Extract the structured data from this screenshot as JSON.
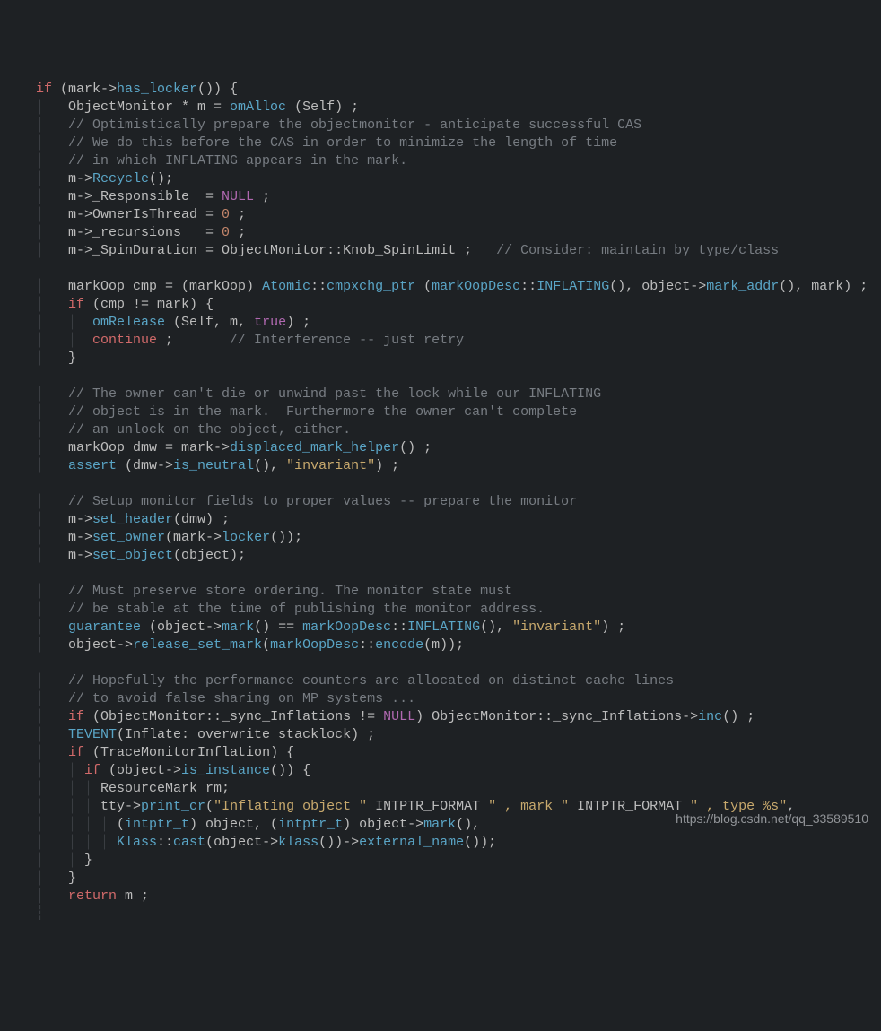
{
  "watermark": "https://blog.csdn.net/qq_33589510",
  "tokens": [
    {
      "t": "kw",
      "v": "if"
    },
    {
      "t": "txt",
      "v": " (mark->"
    },
    {
      "t": "fn",
      "v": "has_locker"
    },
    {
      "t": "txt",
      "v": "()) {"
    },
    {
      "t": "nl"
    },
    {
      "t": "guide",
      "v": "│   "
    },
    {
      "t": "txt",
      "v": "ObjectMonitor * m = "
    },
    {
      "t": "fn",
      "v": "omAlloc"
    },
    {
      "t": "txt",
      "v": " (Self) ;"
    },
    {
      "t": "nl"
    },
    {
      "t": "guide",
      "v": "│   "
    },
    {
      "t": "cmt",
      "v": "// Optimistically prepare the objectmonitor - anticipate successful CAS"
    },
    {
      "t": "nl"
    },
    {
      "t": "guide",
      "v": "│   "
    },
    {
      "t": "cmt",
      "v": "// We do this before the CAS in order to minimize the length of time"
    },
    {
      "t": "nl"
    },
    {
      "t": "guide",
      "v": "│   "
    },
    {
      "t": "cmt",
      "v": "// in which INFLATING appears in the mark."
    },
    {
      "t": "nl"
    },
    {
      "t": "guide",
      "v": "│   "
    },
    {
      "t": "txt",
      "v": "m->"
    },
    {
      "t": "fn",
      "v": "Recycle"
    },
    {
      "t": "txt",
      "v": "();"
    },
    {
      "t": "nl"
    },
    {
      "t": "guide",
      "v": "│   "
    },
    {
      "t": "txt",
      "v": "m->_Responsible  = "
    },
    {
      "t": "null",
      "v": "NULL"
    },
    {
      "t": "txt",
      "v": " ;"
    },
    {
      "t": "nl"
    },
    {
      "t": "guide",
      "v": "│   "
    },
    {
      "t": "txt",
      "v": "m->OwnerIsThread = "
    },
    {
      "t": "num",
      "v": "0"
    },
    {
      "t": "txt",
      "v": " ;"
    },
    {
      "t": "nl"
    },
    {
      "t": "guide",
      "v": "│   "
    },
    {
      "t": "txt",
      "v": "m->_recursions   = "
    },
    {
      "t": "num",
      "v": "0"
    },
    {
      "t": "txt",
      "v": " ;"
    },
    {
      "t": "nl"
    },
    {
      "t": "guide",
      "v": "│   "
    },
    {
      "t": "txt",
      "v": "m->_SpinDuration = ObjectMonitor::Knob_SpinLimit ;   "
    },
    {
      "t": "cmt",
      "v": "// Consider: maintain by type/class"
    },
    {
      "t": "nl"
    },
    {
      "t": "nl"
    },
    {
      "t": "guide",
      "v": "│   "
    },
    {
      "t": "txt",
      "v": "markOop cmp = (markOop) "
    },
    {
      "t": "cls",
      "v": "Atomic"
    },
    {
      "t": "txt",
      "v": "::"
    },
    {
      "t": "fn",
      "v": "cmpxchg_ptr"
    },
    {
      "t": "txt",
      "v": " ("
    },
    {
      "t": "cls",
      "v": "markOopDesc"
    },
    {
      "t": "txt",
      "v": "::"
    },
    {
      "t": "fn",
      "v": "INFLATING"
    },
    {
      "t": "txt",
      "v": "(), object->"
    },
    {
      "t": "fn",
      "v": "mark_addr"
    },
    {
      "t": "txt",
      "v": "(), mark) ;"
    },
    {
      "t": "nl"
    },
    {
      "t": "guide",
      "v": "│   "
    },
    {
      "t": "kw",
      "v": "if"
    },
    {
      "t": "txt",
      "v": " (cmp != mark) {"
    },
    {
      "t": "nl"
    },
    {
      "t": "guide",
      "v": "│   │  "
    },
    {
      "t": "fn",
      "v": "omRelease"
    },
    {
      "t": "txt",
      "v": " (Self, m, "
    },
    {
      "t": "true",
      "v": "true"
    },
    {
      "t": "txt",
      "v": ") ;"
    },
    {
      "t": "nl"
    },
    {
      "t": "guide",
      "v": "│   │  "
    },
    {
      "t": "kw",
      "v": "continue"
    },
    {
      "t": "txt",
      "v": " ;       "
    },
    {
      "t": "cmt",
      "v": "// Interference -- just retry"
    },
    {
      "t": "nl"
    },
    {
      "t": "guide",
      "v": "│   "
    },
    {
      "t": "txt",
      "v": "}"
    },
    {
      "t": "nl"
    },
    {
      "t": "nl"
    },
    {
      "t": "guide",
      "v": "│   "
    },
    {
      "t": "cmt",
      "v": "// The owner can't die or unwind past the lock while our INFLATING"
    },
    {
      "t": "nl"
    },
    {
      "t": "guide",
      "v": "│   "
    },
    {
      "t": "cmt",
      "v": "// object is in the mark.  Furthermore the owner can't complete"
    },
    {
      "t": "nl"
    },
    {
      "t": "guide",
      "v": "│   "
    },
    {
      "t": "cmt",
      "v": "// an unlock on the object, either."
    },
    {
      "t": "nl"
    },
    {
      "t": "guide",
      "v": "│   "
    },
    {
      "t": "txt",
      "v": "markOop dmw = mark->"
    },
    {
      "t": "fn",
      "v": "displaced_mark_helper"
    },
    {
      "t": "txt",
      "v": "() ;"
    },
    {
      "t": "nl"
    },
    {
      "t": "guide",
      "v": "│   "
    },
    {
      "t": "fn",
      "v": "assert"
    },
    {
      "t": "txt",
      "v": " (dmw->"
    },
    {
      "t": "fn",
      "v": "is_neutral"
    },
    {
      "t": "txt",
      "v": "(), "
    },
    {
      "t": "str",
      "v": "\"invariant\""
    },
    {
      "t": "txt",
      "v": ") ;"
    },
    {
      "t": "nl"
    },
    {
      "t": "nl"
    },
    {
      "t": "guide",
      "v": "│   "
    },
    {
      "t": "cmt",
      "v": "// Setup monitor fields to proper values -- prepare the monitor"
    },
    {
      "t": "nl"
    },
    {
      "t": "guide",
      "v": "│   "
    },
    {
      "t": "txt",
      "v": "m->"
    },
    {
      "t": "fn",
      "v": "set_header"
    },
    {
      "t": "txt",
      "v": "(dmw) ;"
    },
    {
      "t": "nl"
    },
    {
      "t": "guide",
      "v": "│   "
    },
    {
      "t": "txt",
      "v": "m->"
    },
    {
      "t": "fn",
      "v": "set_owner"
    },
    {
      "t": "txt",
      "v": "(mark->"
    },
    {
      "t": "fn",
      "v": "locker"
    },
    {
      "t": "txt",
      "v": "());"
    },
    {
      "t": "nl"
    },
    {
      "t": "guide",
      "v": "│   "
    },
    {
      "t": "txt",
      "v": "m->"
    },
    {
      "t": "fn",
      "v": "set_object"
    },
    {
      "t": "txt",
      "v": "(object);"
    },
    {
      "t": "nl"
    },
    {
      "t": "nl"
    },
    {
      "t": "guide",
      "v": "│   "
    },
    {
      "t": "cmt",
      "v": "// Must preserve store ordering. The monitor state must"
    },
    {
      "t": "nl"
    },
    {
      "t": "guide",
      "v": "│   "
    },
    {
      "t": "cmt",
      "v": "// be stable at the time of publishing the monitor address."
    },
    {
      "t": "nl"
    },
    {
      "t": "guide",
      "v": "│   "
    },
    {
      "t": "fn",
      "v": "guarantee"
    },
    {
      "t": "txt",
      "v": " (object->"
    },
    {
      "t": "fn",
      "v": "mark"
    },
    {
      "t": "txt",
      "v": "() == "
    },
    {
      "t": "cls",
      "v": "markOopDesc"
    },
    {
      "t": "txt",
      "v": "::"
    },
    {
      "t": "fn",
      "v": "INFLATING"
    },
    {
      "t": "txt",
      "v": "(), "
    },
    {
      "t": "str",
      "v": "\"invariant\""
    },
    {
      "t": "txt",
      "v": ") ;"
    },
    {
      "t": "nl"
    },
    {
      "t": "guide",
      "v": "│   "
    },
    {
      "t": "txt",
      "v": "object->"
    },
    {
      "t": "fn",
      "v": "release_set_mark"
    },
    {
      "t": "txt",
      "v": "("
    },
    {
      "t": "cls",
      "v": "markOopDesc"
    },
    {
      "t": "txt",
      "v": "::"
    },
    {
      "t": "fn",
      "v": "encode"
    },
    {
      "t": "txt",
      "v": "(m));"
    },
    {
      "t": "nl"
    },
    {
      "t": "nl"
    },
    {
      "t": "guide",
      "v": "│   "
    },
    {
      "t": "cmt",
      "v": "// Hopefully the performance counters are allocated on distinct cache lines"
    },
    {
      "t": "nl"
    },
    {
      "t": "guide",
      "v": "│   "
    },
    {
      "t": "cmt",
      "v": "// to avoid false sharing on MP systems ..."
    },
    {
      "t": "nl"
    },
    {
      "t": "guide",
      "v": "│   "
    },
    {
      "t": "kw",
      "v": "if"
    },
    {
      "t": "txt",
      "v": " (ObjectMonitor::_sync_Inflations != "
    },
    {
      "t": "null",
      "v": "NULL"
    },
    {
      "t": "txt",
      "v": ") ObjectMonitor::_sync_Inflations->"
    },
    {
      "t": "fn",
      "v": "inc"
    },
    {
      "t": "txt",
      "v": "() ;"
    },
    {
      "t": "nl"
    },
    {
      "t": "guide",
      "v": "│   "
    },
    {
      "t": "fn",
      "v": "TEVENT"
    },
    {
      "t": "txt",
      "v": "(Inflate: overwrite stacklock) ;"
    },
    {
      "t": "nl"
    },
    {
      "t": "guide",
      "v": "│   "
    },
    {
      "t": "kw",
      "v": "if"
    },
    {
      "t": "txt",
      "v": " (TraceMonitorInflation) {"
    },
    {
      "t": "nl"
    },
    {
      "t": "guide",
      "v": "│   │ "
    },
    {
      "t": "kw",
      "v": "if"
    },
    {
      "t": "txt",
      "v": " (object->"
    },
    {
      "t": "fn",
      "v": "is_instance"
    },
    {
      "t": "txt",
      "v": "()) {"
    },
    {
      "t": "nl"
    },
    {
      "t": "guide",
      "v": "│   │ │ "
    },
    {
      "t": "txt",
      "v": "ResourceMark rm;"
    },
    {
      "t": "nl"
    },
    {
      "t": "guide",
      "v": "│   │ │ "
    },
    {
      "t": "txt",
      "v": "tty->"
    },
    {
      "t": "fn",
      "v": "print_cr"
    },
    {
      "t": "txt",
      "v": "("
    },
    {
      "t": "str",
      "v": "\"Inflating object \""
    },
    {
      "t": "txt",
      "v": " INTPTR_FORMAT "
    },
    {
      "t": "str",
      "v": "\" , mark \""
    },
    {
      "t": "txt",
      "v": " INTPTR_FORMAT "
    },
    {
      "t": "str",
      "v": "\" , type %s\""
    },
    {
      "t": "txt",
      "v": ","
    },
    {
      "t": "nl"
    },
    {
      "t": "guide",
      "v": "│   │ │ │ "
    },
    {
      "t": "txt",
      "v": "("
    },
    {
      "t": "cls",
      "v": "intptr_t"
    },
    {
      "t": "txt",
      "v": ") object, ("
    },
    {
      "t": "cls",
      "v": "intptr_t"
    },
    {
      "t": "txt",
      "v": ") object->"
    },
    {
      "t": "fn",
      "v": "mark"
    },
    {
      "t": "txt",
      "v": "(),"
    },
    {
      "t": "nl"
    },
    {
      "t": "guide",
      "v": "│   │ │ │ "
    },
    {
      "t": "cls",
      "v": "Klass"
    },
    {
      "t": "txt",
      "v": "::"
    },
    {
      "t": "fn",
      "v": "cast"
    },
    {
      "t": "txt",
      "v": "(object->"
    },
    {
      "t": "fn",
      "v": "klass"
    },
    {
      "t": "txt",
      "v": "())->"
    },
    {
      "t": "fn",
      "v": "external_name"
    },
    {
      "t": "txt",
      "v": "());"
    },
    {
      "t": "nl"
    },
    {
      "t": "guide",
      "v": "│   │ "
    },
    {
      "t": "txt",
      "v": "}"
    },
    {
      "t": "nl"
    },
    {
      "t": "guide",
      "v": "│   "
    },
    {
      "t": "txt",
      "v": "}"
    },
    {
      "t": "nl"
    },
    {
      "t": "guide",
      "v": "│   "
    },
    {
      "t": "kw",
      "v": "return"
    },
    {
      "t": "txt",
      "v": " m ;"
    },
    {
      "t": "nl"
    },
    {
      "t": "guide",
      "v": "┆"
    }
  ]
}
